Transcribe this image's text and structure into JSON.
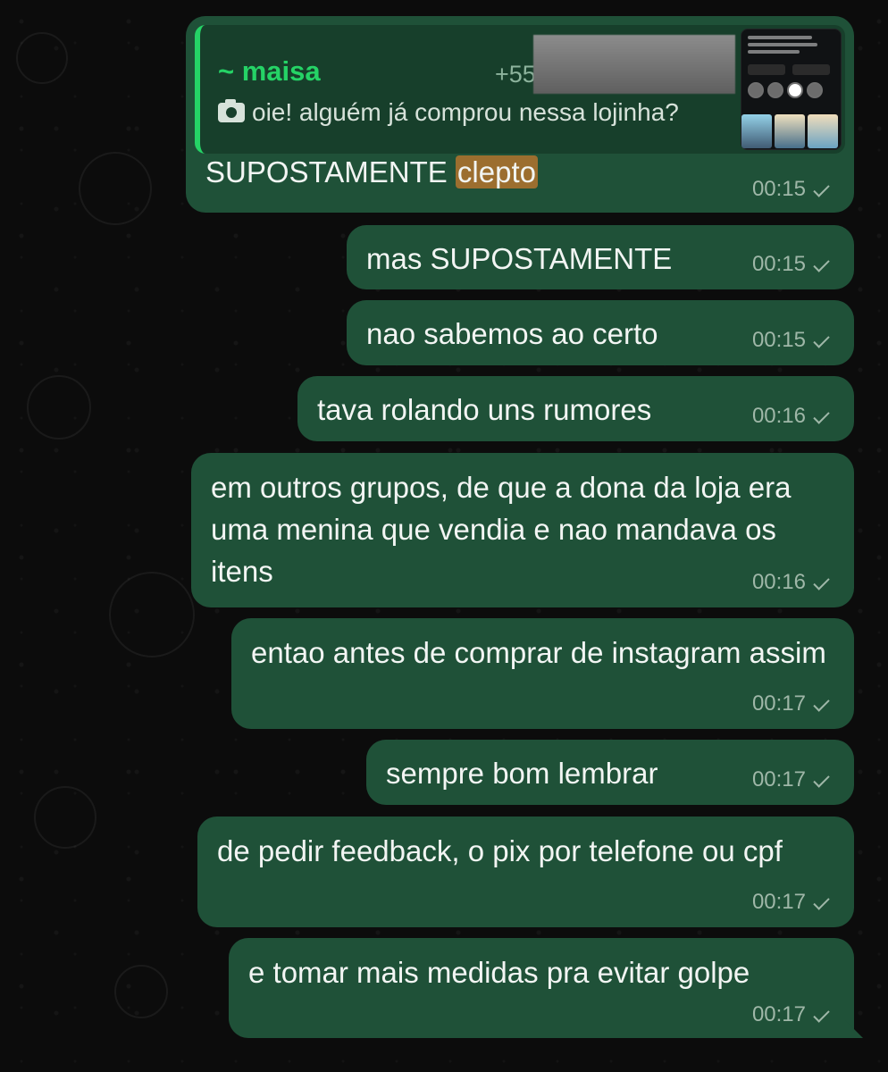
{
  "chat": {
    "quoted_message": {
      "sender": "~ maisa",
      "phone_prefix": "+55",
      "caption": "oie! alguém já comprou nessa lojinha?"
    },
    "messages": [
      {
        "text_prefix": "SUPOSTAMENTE ",
        "highlight": "clepto",
        "time": "00:15"
      },
      {
        "text": "mas SUPOSTAMENTE",
        "time": "00:15"
      },
      {
        "text": "nao sabemos ao certo",
        "time": "00:15"
      },
      {
        "text": "tava rolando uns rumores",
        "time": "00:16"
      },
      {
        "text": "em outros grupos, de que a dona da loja era uma menina que vendia e nao mandava os itens",
        "time": "00:16"
      },
      {
        "text": "entao antes de comprar de instagram assim",
        "time": "00:17"
      },
      {
        "text": "sempre bom lembrar",
        "time": "00:17"
      },
      {
        "text": "de pedir feedback, o pix por telefone ou cpf",
        "time": "00:17"
      },
      {
        "text": "e tomar mais medidas pra evitar golpe",
        "time": "00:17"
      }
    ]
  },
  "theme": {
    "bubble_color": "#1f5138",
    "accent_green": "#25d366",
    "highlight_color": "#9c6e2f"
  },
  "icons": {
    "camera": "camera-icon",
    "read": "single-check-icon"
  }
}
